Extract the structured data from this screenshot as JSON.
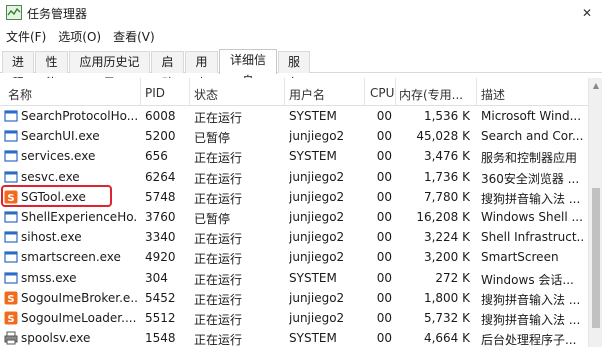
{
  "window": {
    "title": "任务管理器",
    "close_label": "✕"
  },
  "menu": [
    "文件(F)",
    "选项(O)",
    "查看(V)"
  ],
  "tabs": [
    "进程",
    "性能",
    "应用历史记录",
    "启动",
    "用户",
    "详细信息",
    "服务"
  ],
  "active_tab": "详细信息",
  "columns": {
    "name": "名称",
    "pid": "PID",
    "status": "状态",
    "user": "用户名",
    "cpu": "CPU",
    "mem": "内存(专用...",
    "desc": "描述"
  },
  "rows": [
    {
      "icon": "window-icon",
      "name": "SearchProtocolHo...",
      "pid": "6008",
      "status": "正在运行",
      "user": "SYSTEM",
      "cpu": "00",
      "mem": "1,536 K",
      "desc": "Microsoft Wind..."
    },
    {
      "icon": "window-icon",
      "name": "SearchUI.exe",
      "pid": "5200",
      "status": "已暂停",
      "user": "junjiego2",
      "cpu": "00",
      "mem": "45,028 K",
      "desc": "Search and Cor..."
    },
    {
      "icon": "window-icon",
      "name": "services.exe",
      "pid": "656",
      "status": "正在运行",
      "user": "SYSTEM",
      "cpu": "00",
      "mem": "3,476 K",
      "desc": "服务和控制器应用"
    },
    {
      "icon": "window-icon",
      "name": "sesvc.exe",
      "pid": "6264",
      "status": "正在运行",
      "user": "junjiego2",
      "cpu": "00",
      "mem": "1,736 K",
      "desc": "360安全浏览器 ..."
    },
    {
      "icon": "sogou-icon",
      "name": "SGTool.exe",
      "pid": "5748",
      "status": "正在运行",
      "user": "junjiego2",
      "cpu": "00",
      "mem": "7,780 K",
      "desc": "搜狗拼音输入法 ..."
    },
    {
      "icon": "window-icon",
      "name": "ShellExperienceHo...",
      "pid": "3760",
      "status": "已暂停",
      "user": "junjiego2",
      "cpu": "00",
      "mem": "16,208 K",
      "desc": "Windows Shell ..."
    },
    {
      "icon": "window-icon",
      "name": "sihost.exe",
      "pid": "3340",
      "status": "正在运行",
      "user": "junjiego2",
      "cpu": "00",
      "mem": "3,224 K",
      "desc": "Shell Infrastruct..."
    },
    {
      "icon": "window-icon",
      "name": "smartscreen.exe",
      "pid": "4920",
      "status": "正在运行",
      "user": "junjiego2",
      "cpu": "00",
      "mem": "3,200 K",
      "desc": "SmartScreen"
    },
    {
      "icon": "window-icon",
      "name": "smss.exe",
      "pid": "304",
      "status": "正在运行",
      "user": "SYSTEM",
      "cpu": "00",
      "mem": "272 K",
      "desc": "Windows 会话..."
    },
    {
      "icon": "sogou-icon",
      "name": "SogouImeBroker.e...",
      "pid": "5452",
      "status": "正在运行",
      "user": "junjiego2",
      "cpu": "00",
      "mem": "1,800 K",
      "desc": "搜狗拼音输入法 ..."
    },
    {
      "icon": "sogou-icon",
      "name": "SogouImeLoader....",
      "pid": "5512",
      "status": "正在运行",
      "user": "junjiego2",
      "cpu": "00",
      "mem": "5,732 K",
      "desc": "搜狗拼音输入法 ..."
    },
    {
      "icon": "printer-icon",
      "name": "spoolsv.exe",
      "pid": "1548",
      "status": "正在运行",
      "user": "SYSTEM",
      "cpu": "00",
      "mem": "4,664 K",
      "desc": "后台处理程序子..."
    }
  ],
  "colors": {
    "highlight": "#e0242e",
    "sogou": "#f26b1d",
    "window_icon": "#2b6cc4",
    "tab_active": "#ffffff"
  }
}
